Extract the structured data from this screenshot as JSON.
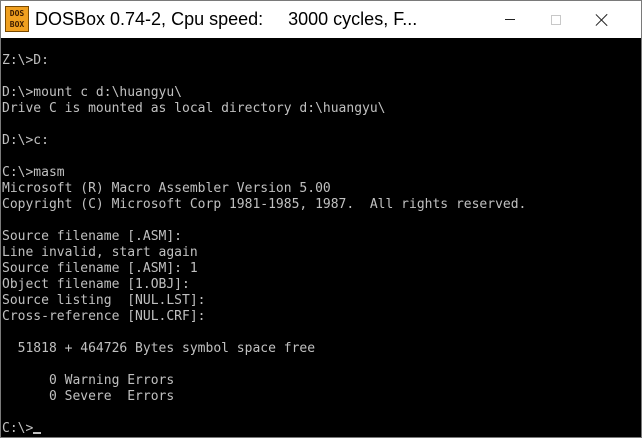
{
  "window": {
    "icon_text": [
      "DOS",
      "BOX"
    ],
    "title": "DOSBox 0.74-2, Cpu speed:     3000 cycles, F..."
  },
  "console": {
    "lines": [
      "Z:\\>D:",
      "",
      "D:\\>mount c d:\\huangyu\\",
      "Drive C is mounted as local directory d:\\huangyu\\",
      "",
      "D:\\>c:",
      "",
      "C:\\>masm",
      "Microsoft (R) Macro Assembler Version 5.00",
      "Copyright (C) Microsoft Corp 1981-1985, 1987.  All rights reserved.",
      "",
      "Source filename [.ASM]:",
      "Line invalid, start again",
      "Source filename [.ASM]: 1",
      "Object filename [1.OBJ]:",
      "Source listing  [NUL.LST]:",
      "Cross-reference [NUL.CRF]:",
      "",
      "  51818 + 464726 Bytes symbol space free",
      "",
      "      0 Warning Errors",
      "      0 Severe  Errors",
      "",
      "C:\\>"
    ]
  }
}
